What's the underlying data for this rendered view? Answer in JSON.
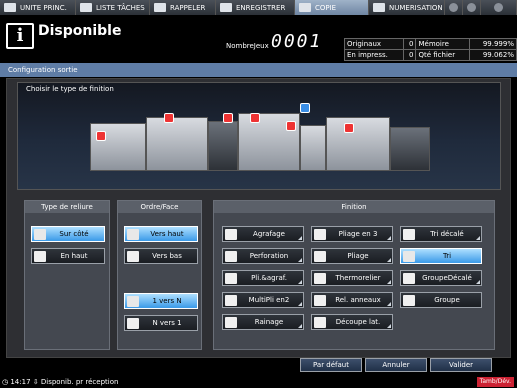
{
  "tabs": [
    {
      "label": "UNITE PRINC.",
      "icon": "home-icon"
    },
    {
      "label": "LISTE TÂCHES",
      "icon": "list-icon"
    },
    {
      "label": "RAPPELER",
      "icon": "recall-icon"
    },
    {
      "label": "ENREGISTRER",
      "icon": "save-icon"
    },
    {
      "label": "COPIE",
      "icon": "copy-icon"
    },
    {
      "label": "NUMERISATION",
      "icon": "scan-icon"
    }
  ],
  "status": {
    "title": "Disponible",
    "jobs_label": "NombreJeux",
    "jobs_value": "0001"
  },
  "counters": {
    "originaux_label": "Originaux",
    "originaux_value": "0",
    "memoire_label": "Mémoire",
    "memoire_value": "99.999%",
    "impress_label": "En impress.",
    "impress_value": "0",
    "qte_label": "Qté fichier",
    "qte_value": "99.062%"
  },
  "config_title": "Configuration sortie",
  "preview_title": "Choisir le type de finition",
  "groups": {
    "reliure": {
      "title": "Type de reliure",
      "buttons": [
        {
          "label": "Sur côté",
          "selected": true
        },
        {
          "label": "En haut",
          "selected": false
        }
      ]
    },
    "ordre": {
      "title": "Ordre/Face",
      "buttons": [
        {
          "label": "Vers haut",
          "selected": true
        },
        {
          "label": "Vers bas",
          "selected": false
        },
        {
          "label": "1 vers N",
          "selected": true
        },
        {
          "label": "N vers 1",
          "selected": false
        }
      ]
    },
    "finition": {
      "title": "Finition",
      "buttons": [
        {
          "label": "Agrafage",
          "selected": false
        },
        {
          "label": "Pliage en 3",
          "selected": false
        },
        {
          "label": "Tri décalé",
          "selected": false
        },
        {
          "label": "Perforation",
          "selected": false
        },
        {
          "label": "Pliage",
          "selected": false
        },
        {
          "label": "Tri",
          "selected": true
        },
        {
          "label": "Pli.&agraf.",
          "selected": false
        },
        {
          "label": "Thermorelier",
          "selected": false
        },
        {
          "label": "GroupeDécalé",
          "selected": false
        },
        {
          "label": "MultiPli en2",
          "selected": false
        },
        {
          "label": "Rel. anneaux",
          "selected": false
        },
        {
          "label": "Groupe",
          "selected": false
        },
        {
          "label": "Rainage",
          "selected": false
        },
        {
          "label": "Découpe lat.",
          "selected": false
        }
      ]
    }
  },
  "footer": {
    "default_label": "Par défaut",
    "cancel_label": "Annuler",
    "ok_label": "Valider"
  },
  "statusbar": {
    "time": "14:17",
    "message": "Disponib. pr réception",
    "badge": "Tamb/Dév."
  },
  "colors": {
    "selected": "#3a9ae8",
    "header_bar": "#5f7da6",
    "warning": "#e33333"
  }
}
